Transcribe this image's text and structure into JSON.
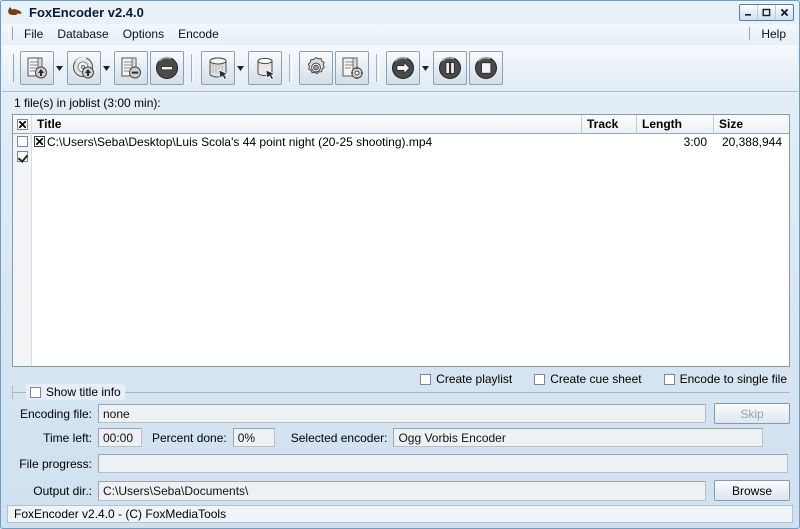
{
  "window": {
    "title": "FoxEncoder v2.4.0",
    "icon": "fox-icon",
    "controls": {
      "minimize": "minimize",
      "maximize": "maximize",
      "close": "close"
    }
  },
  "menubar": {
    "items": [
      {
        "label": "File"
      },
      {
        "label": "Database"
      },
      {
        "label": "Options"
      },
      {
        "label": "Encode"
      }
    ],
    "right": [
      {
        "label": "Help"
      }
    ]
  },
  "toolbar": {
    "groups": [
      {
        "buttons": [
          {
            "name": "add-file-button",
            "icon": "document-add-icon",
            "dropdown": true
          },
          {
            "name": "add-cd-button",
            "icon": "cd-add-icon",
            "dropdown": true
          },
          {
            "name": "remove-file-button",
            "icon": "document-remove-icon",
            "dropdown": false
          },
          {
            "name": "clear-joblist-button",
            "icon": "clear-circle-icon",
            "dropdown": false
          }
        ]
      },
      {
        "buttons": [
          {
            "name": "database-lookup-button",
            "icon": "database-arrow-icon",
            "dropdown": true
          },
          {
            "name": "database-save-button",
            "icon": "database-save-icon",
            "dropdown": false
          }
        ]
      },
      {
        "buttons": [
          {
            "name": "settings-button",
            "icon": "gear-icon",
            "dropdown": false
          },
          {
            "name": "encoder-settings-button",
            "icon": "document-gear-icon",
            "dropdown": false
          }
        ]
      },
      {
        "buttons": [
          {
            "name": "start-encode-button",
            "icon": "play-arrow-icon",
            "dropdown": true
          },
          {
            "name": "pause-encode-button",
            "icon": "pause-icon",
            "dropdown": false
          },
          {
            "name": "stop-encode-button",
            "icon": "stop-icon",
            "dropdown": false
          }
        ]
      }
    ]
  },
  "joblist": {
    "summary": "1 file(s) in joblist (3:00 min):",
    "columns": [
      "Title",
      "Track",
      "Length",
      "Size"
    ],
    "header_checkbox": "xed",
    "rows": [
      {
        "checked": false,
        "title": "C:\\Users\\Seba\\Desktop\\Luis Scola's 44 point night (20-25 shooting).mp4",
        "track": "",
        "length": "3:00",
        "size": "20,388,944"
      }
    ],
    "second_checkbox": "checked"
  },
  "options": [
    {
      "label": "Create playlist",
      "checked": false
    },
    {
      "label": "Create cue sheet",
      "checked": false
    },
    {
      "label": "Encode to single file",
      "checked": false
    }
  ],
  "panel": {
    "group_title": "Show title info",
    "group_checked": false,
    "encoding_file_label": "Encoding file:",
    "encoding_file_value": "none",
    "time_left_label": "Time left:",
    "time_left_value": "00:00",
    "percent_done_label": "Percent done:",
    "percent_done_value": "0%",
    "selected_encoder_label": "Selected encoder:",
    "selected_encoder_value": "Ogg Vorbis Encoder",
    "file_progress_label": "File progress:",
    "file_progress_value": "",
    "output_dir_label": "Output dir.:",
    "output_dir_value": "C:\\Users\\Seba\\Documents\\",
    "skip_button": "Skip",
    "skip_disabled": true,
    "browse_button": "Browse"
  },
  "statusbar": {
    "text": "FoxEncoder v2.4.0 - (C) FoxMediaTools"
  }
}
